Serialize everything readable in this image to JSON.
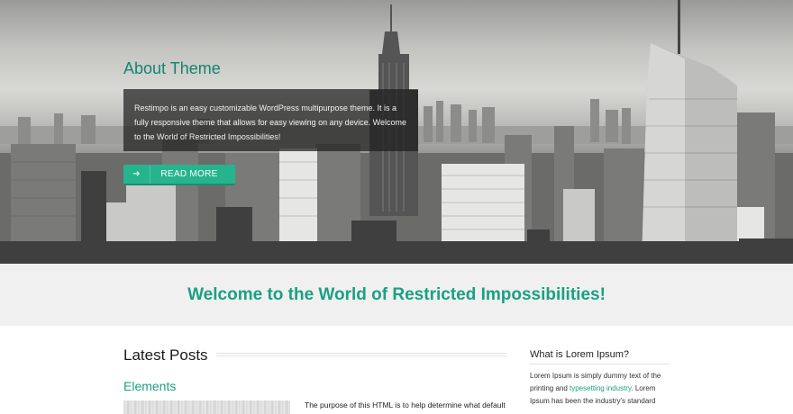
{
  "hero": {
    "title": "About Theme",
    "text": "Restimpo is an easy customizable WordPress multipurpose theme. It is a fully responsive theme that allows for easy viewing on any device. Welcome to the World of Restricted Impossibilities!",
    "button_label": "READ MORE",
    "button_icon": "arrow-right-icon"
  },
  "welcome": {
    "headline": "Welcome to the World of Restricted Impossibilities!"
  },
  "latest_posts": {
    "heading": "Latest Posts",
    "posts": [
      {
        "title": "Elements",
        "excerpt": "The purpose of this HTML is to help determine what default"
      }
    ]
  },
  "sidebar": {
    "title": "What is Lorem Ipsum?",
    "text_before": "Lorem Ipsum is simply dummy text of the printing and ",
    "link_text": "typesetting industry",
    "text_after": ". Lorem Ipsum has been the industry's standard"
  },
  "colors": {
    "accent": "#1aa083",
    "button": "#26b48f",
    "band": "#f0f0f0"
  }
}
